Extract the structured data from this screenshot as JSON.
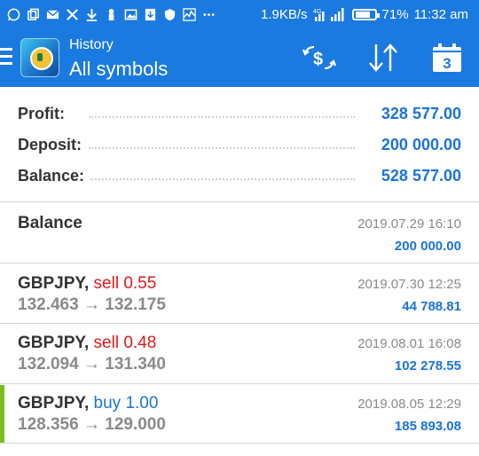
{
  "status_bar": {
    "net_speed": "1.9KB/s",
    "signal": "4G",
    "battery": "71%",
    "time": "11:32 am",
    "icons": [
      "whatsapp-icon",
      "copy-icon",
      "mail-icon",
      "x-icon",
      "download-icon",
      "tag-icon",
      "image-icon",
      "download-box-icon",
      "shield-icon",
      "chart-icon",
      "more-icon"
    ]
  },
  "app_bar": {
    "title": "History",
    "subtitle": "All symbols",
    "calendar_day": "3",
    "actions": [
      "currency-exchange-icon",
      "sort-icon",
      "calendar-icon"
    ]
  },
  "summary": {
    "profit_label": "Profit:",
    "profit_value": "328 577.00",
    "deposit_label": "Deposit:",
    "deposit_value": "200 000.00",
    "balance_label": "Balance:",
    "balance_value": "528 577.00"
  },
  "entries": [
    {
      "type": "balance",
      "title": "Balance",
      "datetime": "2019.07.29 16:10",
      "amount": "200 000.00"
    },
    {
      "type": "trade",
      "symbol": "GBPJPY,",
      "side": "sell 0.55",
      "open": "132.463",
      "arrow": "→",
      "close": "132.175",
      "datetime": "2019.07.30 12:25",
      "profit": "44 788.81"
    },
    {
      "type": "trade",
      "symbol": "GBPJPY,",
      "side": "sell 0.48",
      "open": "132.094",
      "arrow": "→",
      "close": "131.340",
      "datetime": "2019.08.01 16:08",
      "profit": "102 278.55"
    },
    {
      "type": "trade",
      "symbol": "GBPJPY,",
      "side": "buy 1.00",
      "open": "128.356",
      "arrow": "→",
      "close": "129.000",
      "datetime": "2019.08.05 12:29",
      "profit": "185 893.08"
    }
  ],
  "colors": {
    "accent": "#1a7ae0",
    "value_blue": "#1a73d8",
    "sell_red": "#e01818",
    "buy_marker": "#7cbd1e"
  }
}
